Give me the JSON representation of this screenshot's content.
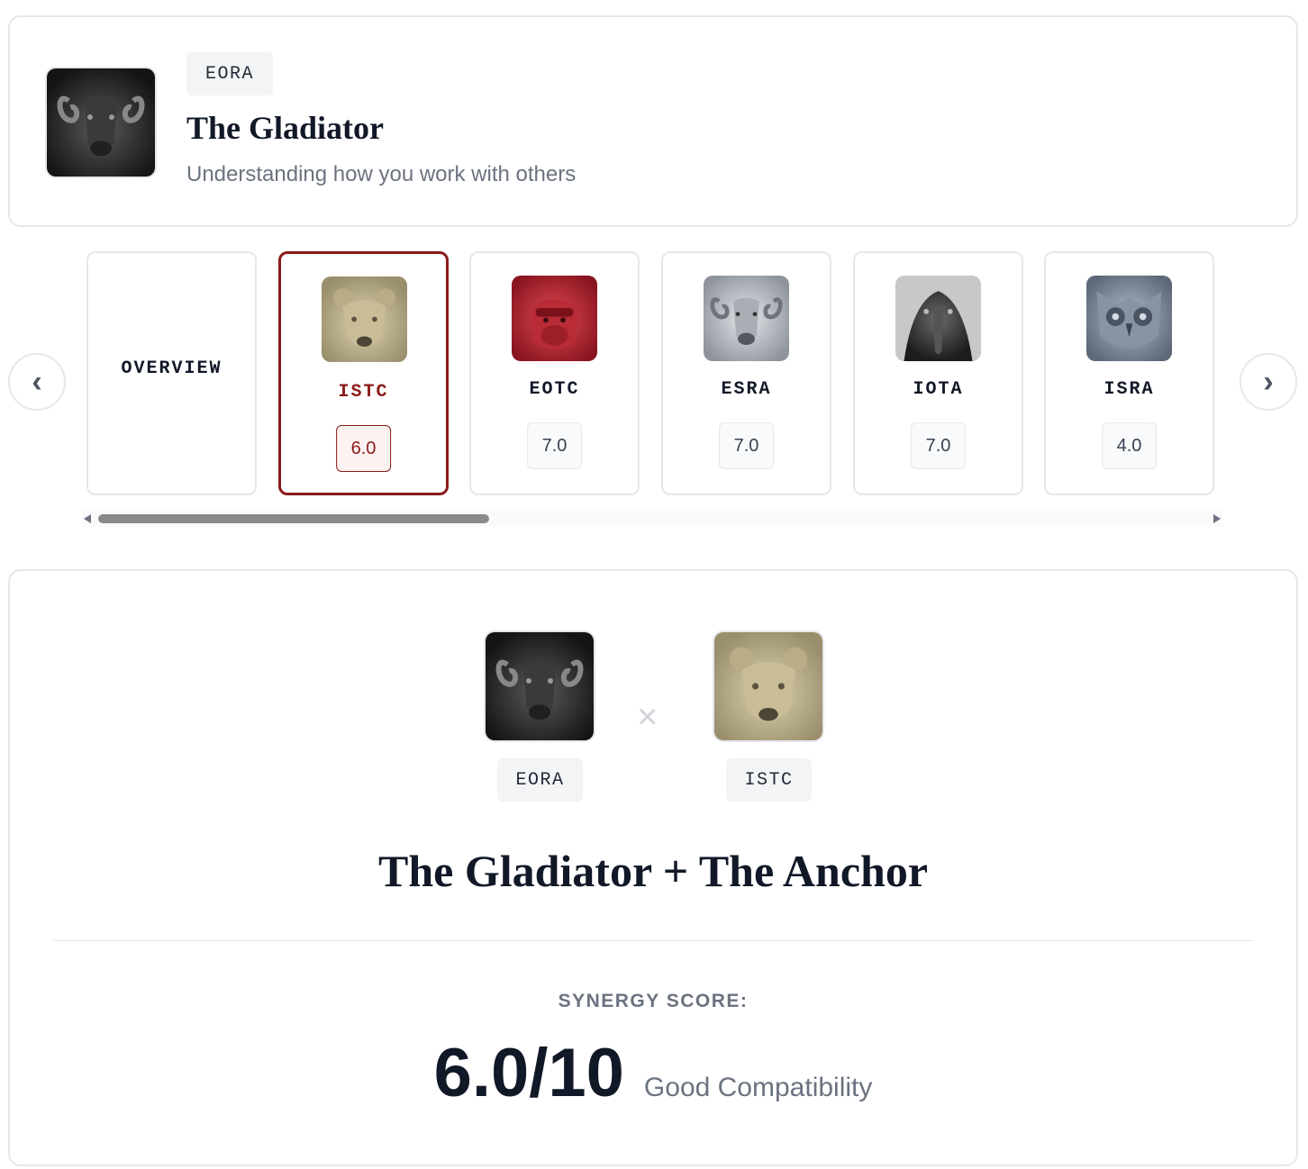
{
  "header": {
    "code": "EORA",
    "title": "The Gladiator",
    "subtitle": "Understanding how you work with others",
    "avatar_icon": "ram-sculpture-icon"
  },
  "carousel": {
    "prev_label": "‹",
    "next_label": "›",
    "selected_index": 1,
    "items": [
      {
        "code": "OVERVIEW",
        "score": null,
        "icon": null
      },
      {
        "code": "ISTC",
        "score": "6.0",
        "icon": "bear-sculpture-icon"
      },
      {
        "code": "EOTC",
        "score": "7.0",
        "icon": "gorilla-sculpture-icon"
      },
      {
        "code": "ESRA",
        "score": "7.0",
        "icon": "ram-sculpture-icon"
      },
      {
        "code": "IOTA",
        "score": "7.0",
        "icon": "eagle-sculpture-icon"
      },
      {
        "code": "ISRA",
        "score": "4.0",
        "icon": "owl-sculpture-icon"
      }
    ],
    "scroll_position": 0.0
  },
  "detail": {
    "left_code": "EORA",
    "right_code": "ISTC",
    "times_symbol": "×",
    "title": "The Gladiator + The Anchor",
    "synergy_label": "SYNERGY SCORE:",
    "synergy_score": "6.0/10",
    "synergy_verdict": "Good Compatibility"
  },
  "colors": {
    "accent": "#8b1a1a",
    "accent_bg": "#fdf2f2",
    "border": "#e5e7eb",
    "muted_text": "#6b7280"
  }
}
